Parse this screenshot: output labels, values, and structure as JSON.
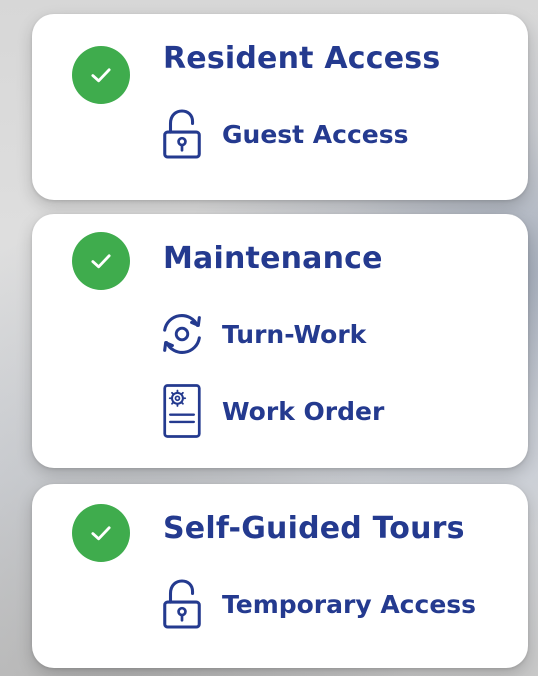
{
  "colors": {
    "accent": "#243a8f",
    "check": "#3fac4d",
    "card": "#ffffff"
  },
  "cards": [
    {
      "title": "Resident Access",
      "status_icon": "check-icon",
      "items": [
        {
          "label": "Guest Access",
          "icon": "padlock-icon"
        }
      ]
    },
    {
      "title": "Maintenance",
      "status_icon": "check-icon",
      "items": [
        {
          "label": "Turn-Work",
          "icon": "refresh-gear-icon"
        },
        {
          "label": "Work Order",
          "icon": "work-order-document-icon"
        }
      ]
    },
    {
      "title": "Self-Guided Tours",
      "status_icon": "check-icon",
      "items": [
        {
          "label": "Temporary Access",
          "icon": "padlock-icon"
        }
      ]
    }
  ]
}
